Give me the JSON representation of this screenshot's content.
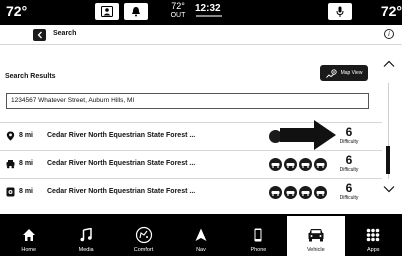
{
  "status": {
    "temp_left": "72°",
    "temp_right": "72°",
    "outside_temp": "72°",
    "outside_label": "OUT",
    "time": "12:32"
  },
  "header": {
    "title": "Search"
  },
  "results": {
    "label": "Search Results",
    "map_view_label": "Map View",
    "address": "1234567 Whatever Street, Auburn Hills, MI",
    "rows": [
      {
        "icon": "location-pin-icon",
        "distance": "8 mi",
        "name": "Cedar River North Equestrian State Forest ...",
        "difficulty": "6",
        "difficulty_label": "Difficulty"
      },
      {
        "icon": "offroad-vehicle-icon",
        "distance": "8 mi",
        "name": "Cedar River North Equestrian State Forest ...",
        "difficulty": "6",
        "difficulty_label": "Difficulty"
      },
      {
        "icon": "trail-marker-icon",
        "distance": "8 mi",
        "name": "Cedar River North Equestrian State Forest ...",
        "difficulty": "6",
        "difficulty_label": "Difficulty"
      }
    ]
  },
  "nav": {
    "items": [
      {
        "label": "Home",
        "icon": "home-icon"
      },
      {
        "label": "Media",
        "icon": "music-note-icon"
      },
      {
        "label": "Comfort",
        "icon": "climate-icon"
      },
      {
        "label": "Nav",
        "icon": "navigation-arrow-icon"
      },
      {
        "label": "Phone",
        "icon": "phone-icon"
      },
      {
        "label": "Vehicle",
        "icon": "vehicle-icon"
      },
      {
        "label": "Apps",
        "icon": "apps-grid-icon"
      }
    ],
    "active": "Vehicle"
  },
  "colors": {
    "background": "#000000",
    "panel": "#ffffff",
    "accent": "#1a1a1a"
  }
}
